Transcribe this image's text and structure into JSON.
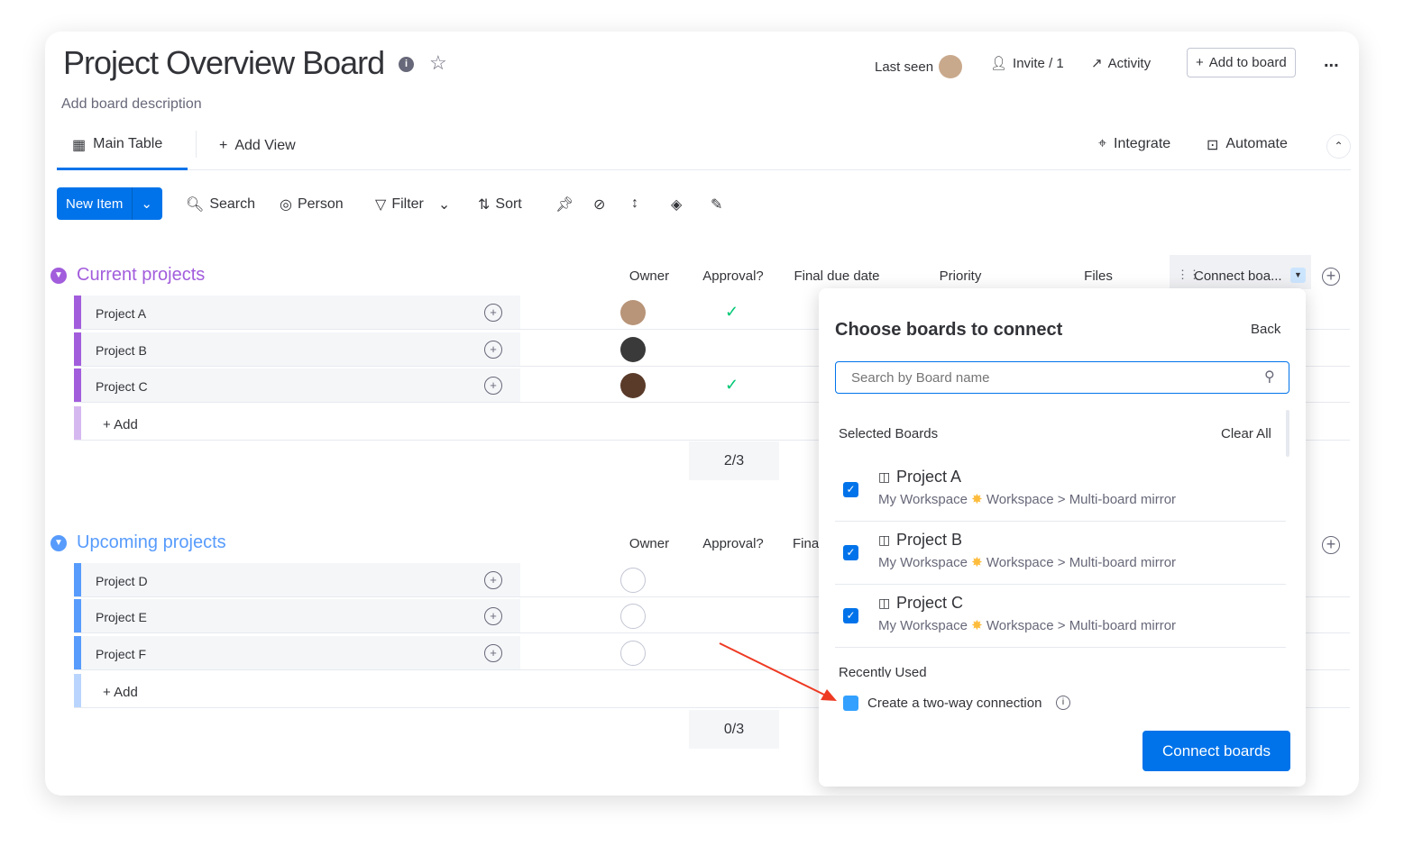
{
  "header": {
    "title": "Project Overview Board",
    "description": "Add board description",
    "last_seen": "Last seen",
    "invite": "Invite / 1",
    "activity": "Activity",
    "add_to_board": "Add to board",
    "more": "..."
  },
  "tabs": {
    "main_table": "Main Table",
    "add_view": "Add View",
    "integrate": "Integrate",
    "automate": "Automate"
  },
  "toolbar": {
    "new_item": "New Item",
    "search": "Search",
    "person": "Person",
    "filter": "Filter",
    "sort": "Sort"
  },
  "columns": {
    "owner": "Owner",
    "approval": "Approval?",
    "due": "Final due date",
    "priority": "Priority",
    "files": "Files",
    "connect": "Connect boa..."
  },
  "groups": [
    {
      "name": "Current projects",
      "color": "#a25ddc",
      "items": [
        {
          "name": "Project A",
          "approved": true
        },
        {
          "name": "Project B",
          "approved": false
        },
        {
          "name": "Project C",
          "approved": true
        }
      ],
      "add": "+ Add",
      "summary": "2/3"
    },
    {
      "name": "Upcoming projects",
      "color": "#579bfc",
      "items": [
        {
          "name": "Project D"
        },
        {
          "name": "Project E"
        },
        {
          "name": "Project F"
        }
      ],
      "add": "+ Add",
      "summary": "0/3",
      "due_partial": "Fina"
    }
  ],
  "popup": {
    "title": "Choose boards to connect",
    "back": "Back",
    "search_placeholder": "Search by Board name",
    "selected_label": "Selected Boards",
    "clear_all": "Clear All",
    "boards": [
      {
        "name": "Project A",
        "path": "My Workspace",
        "path2": "Workspace > Multi-board mirror",
        "checked": true
      },
      {
        "name": "Project B",
        "path": "My Workspace",
        "path2": "Workspace > Multi-board mirror",
        "checked": true
      },
      {
        "name": "Project C",
        "path": "My Workspace",
        "path2": "Workspace > Multi-board mirror",
        "checked": true
      }
    ],
    "recently_used": "Recently Used",
    "two_way": "Create a two-way connection",
    "connect": "Connect boards"
  },
  "colors": {
    "primary": "#0073ea",
    "annotation_arrow": "#ee3a23",
    "check": "#00c875"
  }
}
